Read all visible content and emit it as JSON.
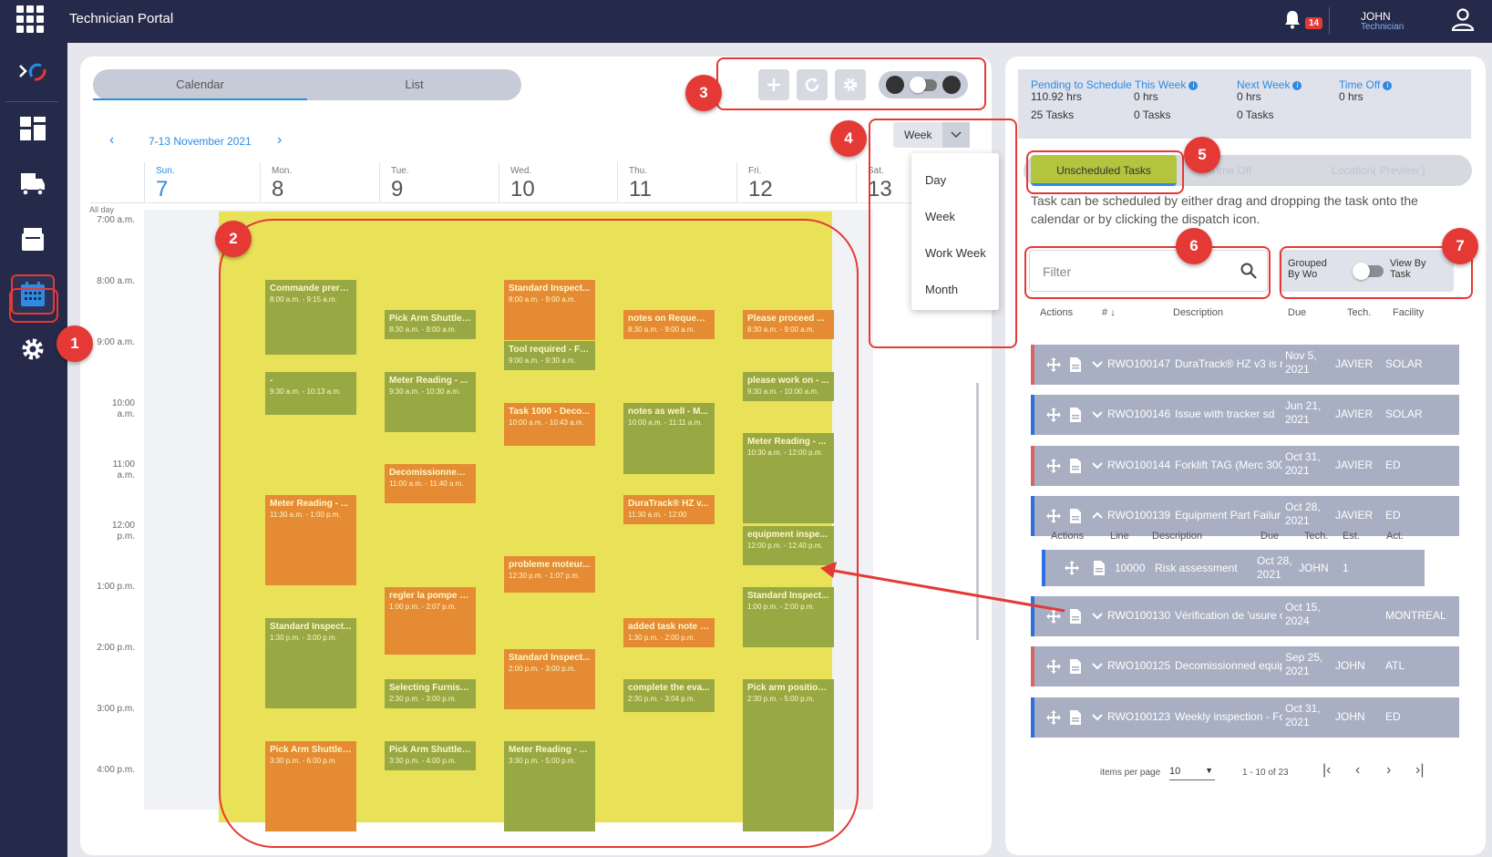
{
  "header": {
    "title": "Technician Portal",
    "notifications": "14",
    "user_name": "JOHN",
    "user_role": "Technician"
  },
  "sidebar": {
    "items": [
      {
        "name": "logo-icon",
        "active": false
      },
      {
        "name": "dashboard-icon",
        "active": false
      },
      {
        "name": "truck-icon",
        "active": false
      },
      {
        "name": "inbox-icon",
        "active": false
      },
      {
        "name": "calendar-icon",
        "active": true
      },
      {
        "name": "gear-icon",
        "active": false
      }
    ]
  },
  "calendar": {
    "tabs": [
      "Calendar",
      "List"
    ],
    "active_tab": "Calendar",
    "date_range": "7-13 November 2021",
    "view_select": "Week",
    "view_options": [
      "Day",
      "Week",
      "Work Week",
      "Month"
    ],
    "all_day": "All day",
    "days": [
      {
        "name": "Sun.",
        "num": "7",
        "today": true
      },
      {
        "name": "Mon.",
        "num": "8"
      },
      {
        "name": "Tue.",
        "num": "9"
      },
      {
        "name": "Wed.",
        "num": "10"
      },
      {
        "name": "Thu.",
        "num": "11"
      },
      {
        "name": "Fri.",
        "num": "12"
      },
      {
        "name": "Sat.",
        "num": "13"
      }
    ],
    "times": [
      "7:00 a.m.",
      "8:00 a.m.",
      "9:00 a.m.",
      "10:00 a.m.",
      "11:00 a.m.",
      "12:00 p.m.",
      "1:00 p.m.",
      "2:00 p.m.",
      "3:00 p.m.",
      "4:00 p.m."
    ],
    "events": [
      {
        "day": 1,
        "start": 8.0,
        "end": 9.25,
        "color": "g",
        "title": "Commande prere...",
        "time": "8:00 a.m. - 9:15 a.m."
      },
      {
        "day": 1,
        "start": 9.5,
        "end": 10.22,
        "color": "g",
        "title": "-",
        "time": "9:30 a.m. - 10:13 a.m."
      },
      {
        "day": 1,
        "start": 11.5,
        "end": 13.0,
        "color": "o",
        "title": "Meter Reading - ...",
        "time": "11:30 a.m. - 1:00 p.m."
      },
      {
        "day": 1,
        "start": 13.5,
        "end": 15.0,
        "color": "g",
        "title": "Standard Inspect...",
        "time": "1:30 p.m. - 3:00 p.m."
      },
      {
        "day": 1,
        "start": 15.5,
        "end": 17.0,
        "color": "o",
        "title": "Pick Arm Shuttle ...",
        "time": "3:30 p.m. - 6:00 p.m."
      },
      {
        "day": 2,
        "start": 8.5,
        "end": 9.0,
        "color": "g",
        "title": "Pick Arm Shuttle ...",
        "time": "8:30 a.m. - 9:00 a.m."
      },
      {
        "day": 2,
        "start": 9.5,
        "end": 10.5,
        "color": "g",
        "title": "Meter Reading - ...",
        "time": "9:30 a.m. - 10:30 a.m."
      },
      {
        "day": 2,
        "start": 11.0,
        "end": 11.67,
        "color": "o",
        "title": "Decomissionned ...",
        "time": "11:00 a.m. - 11:40 a.m."
      },
      {
        "day": 2,
        "start": 13.0,
        "end": 14.12,
        "color": "o",
        "title": "regler la pompe - ...",
        "time": "1:00 p.m. - 2:07 p.m."
      },
      {
        "day": 2,
        "start": 14.5,
        "end": 15.0,
        "color": "g",
        "title": "Selecting Furnish...",
        "time": "2:30 p.m. - 3:00 p.m."
      },
      {
        "day": 2,
        "start": 15.5,
        "end": 16.0,
        "color": "g",
        "title": "Pick Arm Shuttle ...",
        "time": "3:30 p.m. - 4:00 p.m."
      },
      {
        "day": 3,
        "start": 8.0,
        "end": 9.0,
        "color": "o",
        "title": "Standard Inspect...",
        "time": "8:00 a.m. - 9:00 a.m."
      },
      {
        "day": 3,
        "start": 9.0,
        "end": 9.5,
        "color": "g",
        "title": "Tool required - Fo...",
        "time": "9:00 a.m. - 9:30 a.m."
      },
      {
        "day": 3,
        "start": 10.0,
        "end": 10.72,
        "color": "o",
        "title": "Task 1000 - Deco...",
        "time": "10:00 a.m. - 10:43 a.m."
      },
      {
        "day": 3,
        "start": 12.5,
        "end": 13.12,
        "color": "o",
        "title": "probleme moteur...",
        "time": "12:30 p.m. - 1:07 p.m."
      },
      {
        "day": 3,
        "start": 14.0,
        "end": 15.0,
        "color": "o",
        "title": "Standard Inspect...",
        "time": "2:00 p.m. - 3:00 p.m."
      },
      {
        "day": 3,
        "start": 15.5,
        "end": 17.0,
        "color": "g",
        "title": "Meter Reading - ...",
        "time": "3:30 p.m. - 5:00 p.m."
      },
      {
        "day": 4,
        "start": 8.5,
        "end": 9.0,
        "color": "o",
        "title": "notes on Request...",
        "time": "8:30 a.m. - 9:00 a.m."
      },
      {
        "day": 4,
        "start": 10.0,
        "end": 11.18,
        "color": "g",
        "title": "notes as well - M...",
        "time": "10:00 a.m. - 11:11 a.m."
      },
      {
        "day": 4,
        "start": 11.5,
        "end": 12.0,
        "color": "o",
        "title": "DuraTrack® HZ v...",
        "time": "11:30 a.m. - 12:00"
      },
      {
        "day": 4,
        "start": 13.5,
        "end": 14.0,
        "color": "o",
        "title": "added task note -...",
        "time": "1:30 p.m. - 2:00 p.m."
      },
      {
        "day": 4,
        "start": 14.5,
        "end": 15.07,
        "color": "g",
        "title": "complete the eva...",
        "time": "2:30 p.m. - 3:04 p.m."
      },
      {
        "day": 5,
        "start": 8.5,
        "end": 9.0,
        "color": "o",
        "title": "Please proceed ...",
        "time": "8:30 a.m. - 9:00 a.m."
      },
      {
        "day": 5,
        "start": 9.5,
        "end": 10.0,
        "color": "g",
        "title": "please work on - ...",
        "time": "9:30 a.m. - 10:00 a.m."
      },
      {
        "day": 5,
        "start": 10.5,
        "end": 12.0,
        "color": "g",
        "title": "Meter Reading - ...",
        "time": "10:30 a.m. - 12:00 p.m."
      },
      {
        "day": 5,
        "start": 12.0,
        "end": 12.67,
        "color": "g",
        "title": "equipment inspe...",
        "time": "12:00 p.m. - 12:40 p.m."
      },
      {
        "day": 5,
        "start": 13.0,
        "end": 14.0,
        "color": "g",
        "title": "Standard Inspect...",
        "time": "1:00 p.m. - 2:00 p.m."
      },
      {
        "day": 5,
        "start": 14.5,
        "end": 17.0,
        "color": "g",
        "title": "Pick arm position...",
        "time": "2:30 p.m. - 5:00 p.m."
      }
    ]
  },
  "stats": {
    "pending_label": "Pending to Schedule This Week",
    "pending_hrs": "110.92 hrs",
    "pending_tasks": "25 Tasks",
    "col2_hrs": "0 hrs",
    "col2_tasks": "0 Tasks",
    "next_label": "Next Week",
    "next_hrs": "0 hrs",
    "next_tasks": "0 Tasks",
    "timeoff_label": "Time Off",
    "timeoff_hrs": "0 hrs"
  },
  "tasks": {
    "tabs": [
      "Unscheduled Tasks",
      "Time Off",
      "Location( Preview )"
    ],
    "help": "Task can be scheduled by either drag and dropping the task onto the calendar or by clicking the dispatch icon.",
    "filter_placeholder": "Filter",
    "group_left": "Grouped By Wo",
    "group_right": "View By Task",
    "headers": [
      "Actions",
      "#",
      "Description",
      "Due",
      "Tech.",
      "Facility"
    ],
    "rows": [
      {
        "wo": "RWO100147",
        "desc": "DuraTrack® HZ v3 is r",
        "due": "Nov 5, 2021",
        "tech": "JAVIER",
        "facility": "SOLAR",
        "color": "red",
        "expanded": false
      },
      {
        "wo": "RWO100146",
        "desc": "Issue with tracker sd",
        "due": "Jun 21, 2021",
        "tech": "JAVIER",
        "facility": "SOLAR",
        "color": "blue",
        "expanded": false
      },
      {
        "wo": "RWO100144",
        "desc": "Forklift TAG (Merc 300",
        "due": "Oct 31, 2021",
        "tech": "JAVIER",
        "facility": "ED",
        "color": "red",
        "expanded": false
      },
      {
        "wo": "RWO100139",
        "desc": "Equipment Part Failur",
        "due": "Oct 28, 2021",
        "tech": "JAVIER",
        "facility": "ED",
        "color": "blue",
        "expanded": true
      },
      {
        "wo": "RWO100130",
        "desc": "Vérification de 'usure c",
        "due": "Oct 15, 2024",
        "tech": "",
        "facility": "MONTREAL",
        "color": "blue",
        "expanded": false
      },
      {
        "wo": "RWO100125",
        "desc": "Decomissionned equip",
        "due": "Sep 25, 2021",
        "tech": "JOHN",
        "facility": "ATL",
        "color": "red",
        "expanded": false
      },
      {
        "wo": "RWO100123",
        "desc": "Weekly inspection - Fo",
        "due": "Oct 31, 2021",
        "tech": "JOHN",
        "facility": "ED",
        "color": "blue",
        "expanded": false
      }
    ],
    "sub_headers": [
      "Actions",
      "Line",
      "Description",
      "Due",
      "Tech.",
      "Est.",
      "Act."
    ],
    "sub_row": {
      "line": "10000",
      "desc": "Risk assessment",
      "due": "Oct 28, 2021",
      "tech": "JOHN",
      "est": "1",
      "act": ""
    },
    "pager": {
      "ipp_label": "items per page",
      "ipp": "10",
      "range": "1 - 10 of 23"
    }
  },
  "annotations": [
    "1",
    "2",
    "3",
    "4",
    "5",
    "6",
    "7"
  ],
  "colors": {
    "topbar": "#262a4a",
    "accent": "#2d8be3",
    "event_green": "#98a842",
    "event_orange": "#e48b33",
    "highlight": "#e9e258",
    "annotation": "#e53935"
  }
}
